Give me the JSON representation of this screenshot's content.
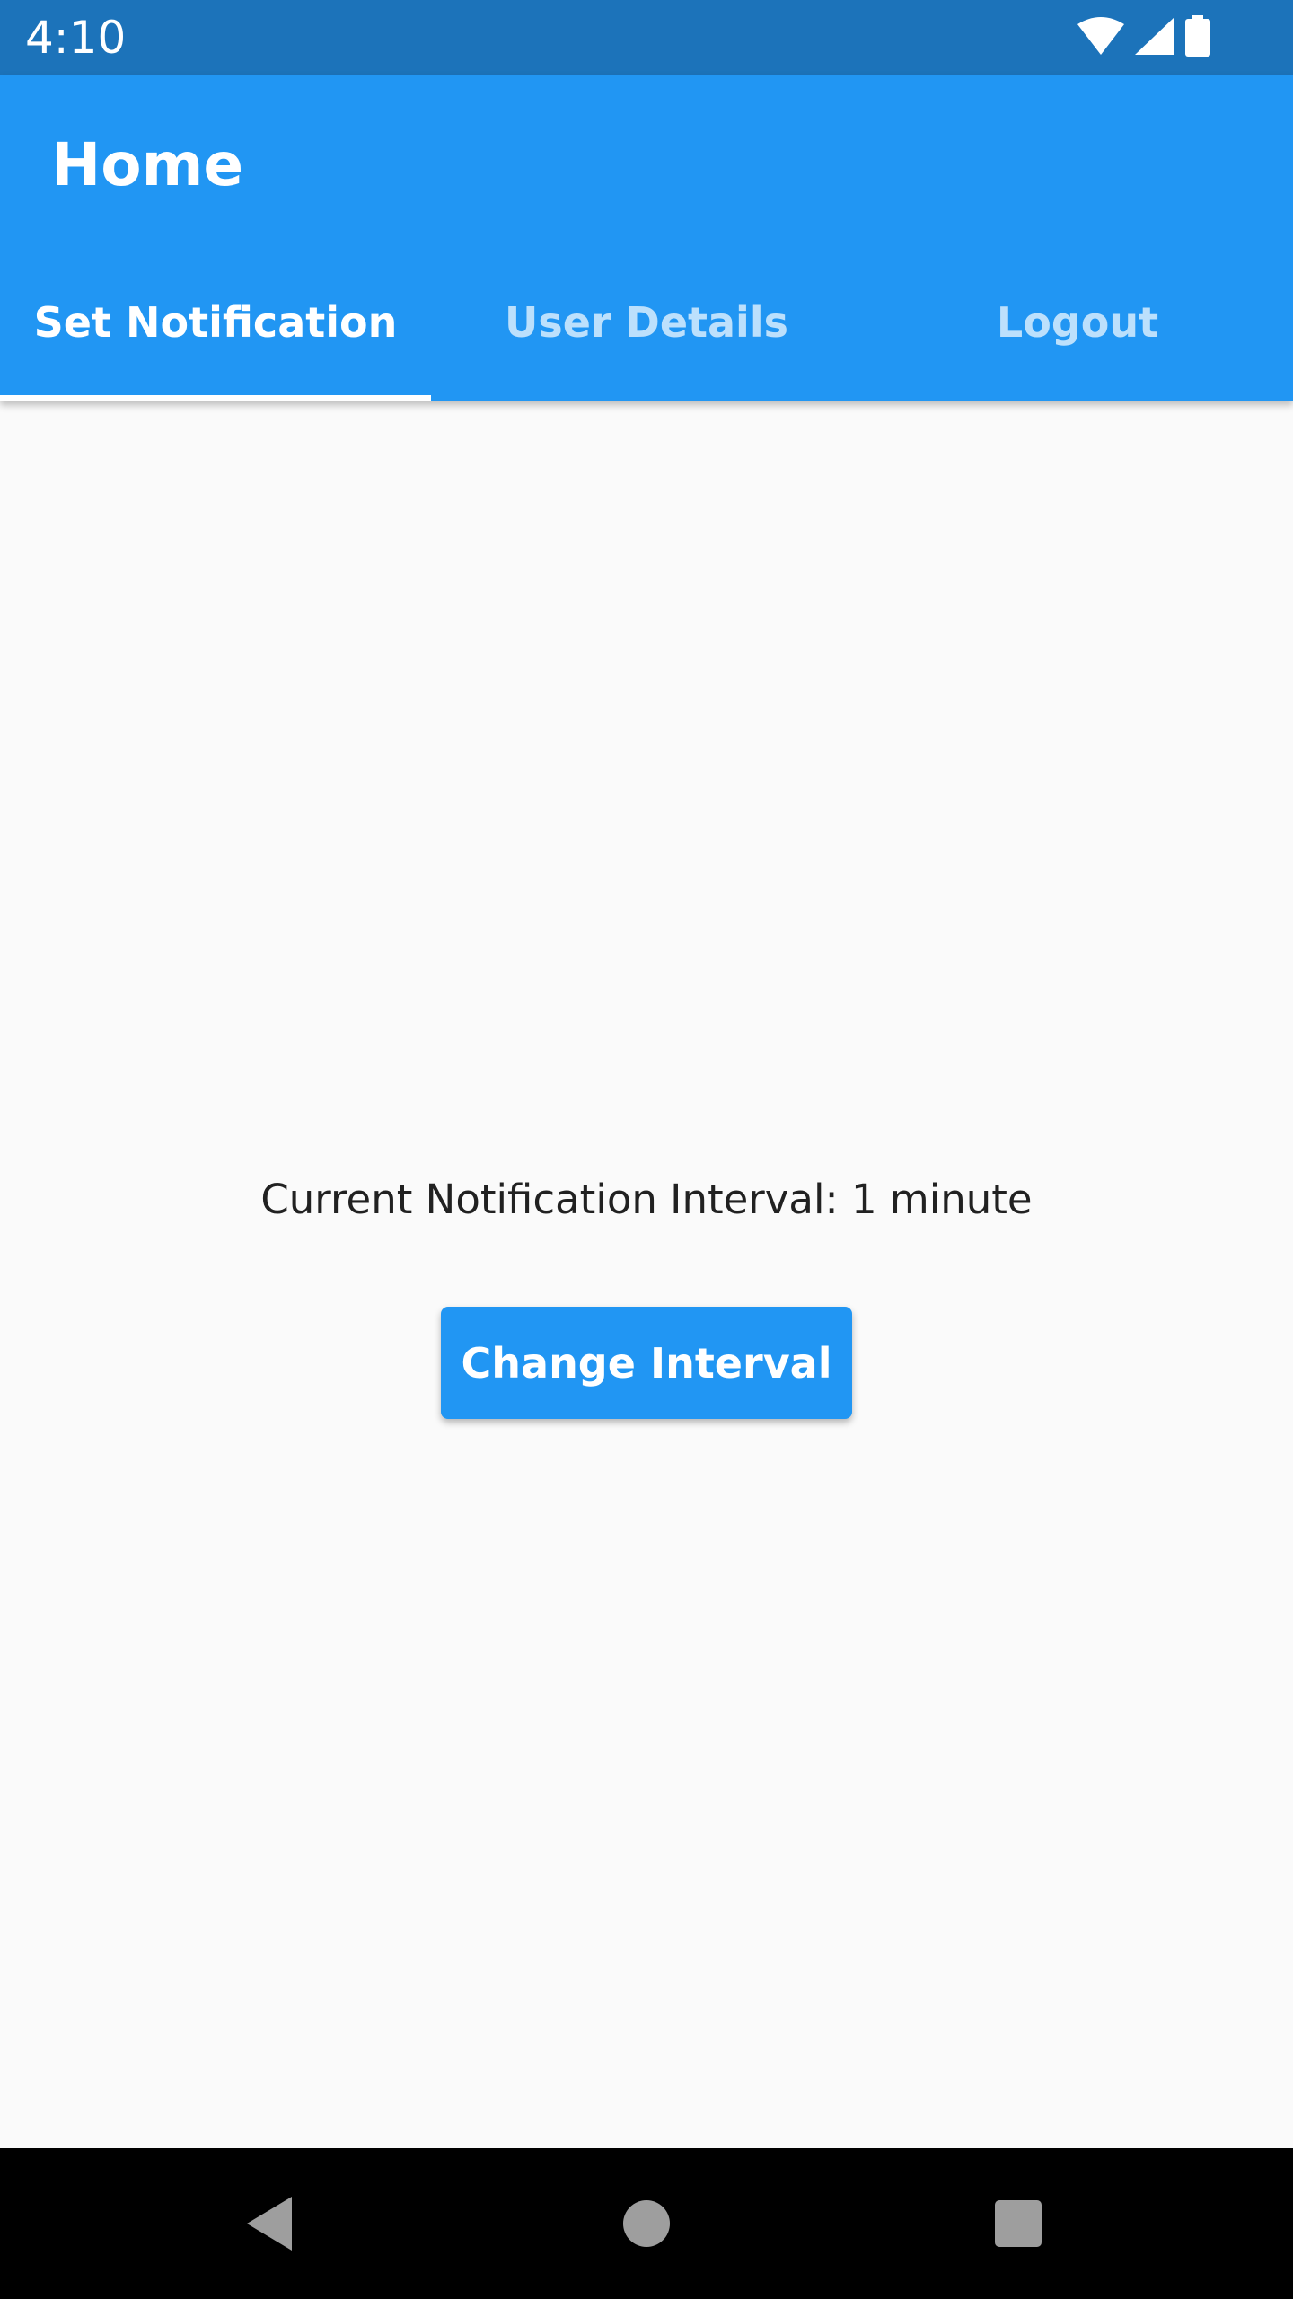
{
  "status_bar": {
    "time": "4:10",
    "icons": [
      "wifi-icon",
      "signal-icon",
      "battery-icon"
    ]
  },
  "app_bar": {
    "title": "Home",
    "tabs": [
      {
        "label": "Set Notification",
        "active": true
      },
      {
        "label": "User Details",
        "active": false
      },
      {
        "label": "Logout",
        "active": false
      }
    ]
  },
  "main": {
    "interval_text": "Current Notification Interval: 1 minute",
    "change_button_label": "Change Interval"
  },
  "nav_bar": {
    "icons": [
      "back-icon",
      "home-icon",
      "recents-icon"
    ]
  },
  "colors": {
    "status_bar": "#1C73BA",
    "app_bar": "#2196F3",
    "background": "#FAFAFA",
    "button": "#2196F3",
    "nav_bar": "#000000"
  }
}
